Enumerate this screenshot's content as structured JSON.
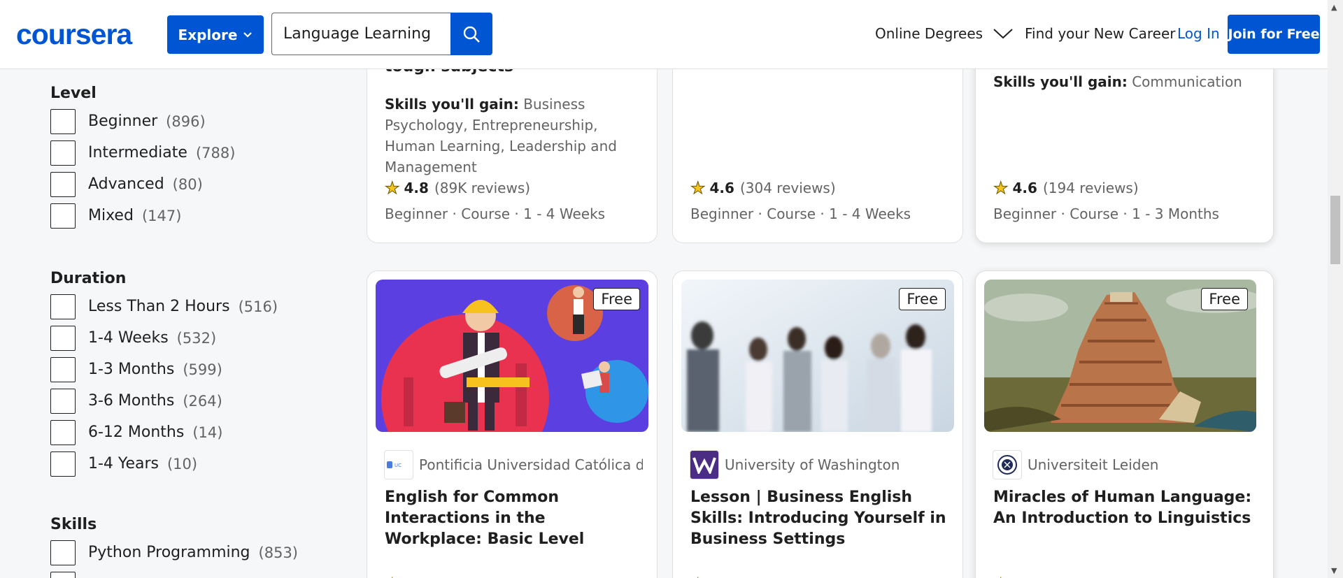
{
  "header": {
    "logo": "coursera",
    "explore_label": "Explore",
    "search_value": "Language Learning",
    "nav_degrees": "Online Degrees",
    "nav_career": "Find your New Career",
    "login": "Log In",
    "join": "Join for Free"
  },
  "filters": {
    "level": {
      "title": "Level",
      "items": [
        {
          "label": "Beginner",
          "count": "(896)"
        },
        {
          "label": "Intermediate",
          "count": "(788)"
        },
        {
          "label": "Advanced",
          "count": "(80)"
        },
        {
          "label": "Mixed",
          "count": "(147)"
        }
      ]
    },
    "duration": {
      "title": "Duration",
      "items": [
        {
          "label": "Less Than 2 Hours",
          "count": "(516)"
        },
        {
          "label": "1-4 Weeks",
          "count": "(532)"
        },
        {
          "label": "1-3 Months",
          "count": "(599)"
        },
        {
          "label": "3-6 Months",
          "count": "(264)"
        },
        {
          "label": "6-12 Months",
          "count": "(14)"
        },
        {
          "label": "1-4 Years",
          "count": "(10)"
        }
      ]
    },
    "skills": {
      "title": "Skills",
      "items": [
        {
          "label": "Python Programming",
          "count": "(853)"
        }
      ]
    }
  },
  "top_cards": [
    {
      "cut_title": "tough subjects",
      "skills_label": "Skills you'll gain:",
      "skills": "Business Psychology, Entrepreneurship, Human Learning, Leadership and Management",
      "rating": "4.8",
      "reviews": "(89K reviews)",
      "meta": "Beginner · Course · 1 - 4 Weeks"
    },
    {
      "cut_title": "",
      "skills_label": "",
      "skills": "",
      "rating": "4.6",
      "reviews": "(304 reviews)",
      "meta": "Beginner · Course · 1 - 4 Weeks"
    },
    {
      "cut_title": "",
      "skills_label": "Skills you'll gain:",
      "skills": "Communication",
      "rating": "4.6",
      "reviews": "(194 reviews)",
      "meta": "Beginner · Course · 1 - 3 Months"
    }
  ],
  "bottom_cards": [
    {
      "badge": "Free",
      "partner": "Pontificia Universidad Católica de...",
      "title": "English for Common Interactions in the Workplace: Basic Level"
    },
    {
      "badge": "Free",
      "partner": "University of Washington",
      "title": "Lesson | Business English Skills: Introducing Yourself in Business Settings"
    },
    {
      "badge": "Free",
      "partner": "Universiteit Leiden",
      "title": "Miracles of Human Language: An Introduction to Linguistics"
    }
  ],
  "colors": {
    "brand": "#0056d2",
    "star": "#f5c518"
  }
}
